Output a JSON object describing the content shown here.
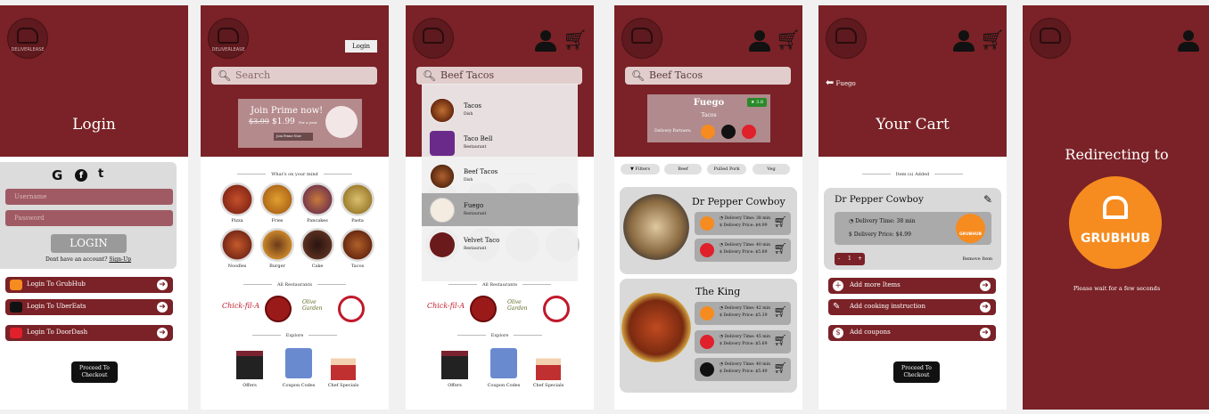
{
  "s1": {
    "title": "Login",
    "username": "Username",
    "password": "Password",
    "login": "LOGIN",
    "noacct": "Dont have an account?",
    "signup": "Sign-Up",
    "btns": [
      "Login To GrubHub",
      "Login To UberEats",
      "Login To DoorDash"
    ],
    "checkout": "Proceed To Checkout",
    "social": [
      "G",
      "f",
      "t"
    ],
    "logo": "DELIVERLEASE"
  },
  "s2": {
    "login": "Login",
    "search": "Search",
    "prime_title": "Join Prime now!",
    "prime_old": "$3.99",
    "prime_price": "$1.99",
    "prime_per": "For a year",
    "prime_btn": "Join Prime Now",
    "mind": "What's on your mind",
    "foods": [
      "Pizza",
      "Fries",
      "Pancakes",
      "Pasta",
      "Noodles",
      "Burger",
      "Cake",
      "Tacos"
    ],
    "allrest": "All Restaurants",
    "rests": [
      "Chick-fil-A",
      "Chipotle",
      "Olive Garden",
      "Panda Express"
    ],
    "explore": "Explore",
    "explore_items": [
      "Offers",
      "Coupon Codes",
      "Chef Specials"
    ],
    "logo": "DELIVERLEASE"
  },
  "s3": {
    "search": "Beef Tacos",
    "results": [
      {
        "name": "Tacos",
        "type": "Dish"
      },
      {
        "name": "Taco Bell",
        "type": "Restaurant"
      },
      {
        "name": "Beef Tacos",
        "type": "Dish"
      },
      {
        "name": "Fuego",
        "type": "Restaurant"
      },
      {
        "name": "Velvet Taco",
        "type": "Restaurant"
      }
    ],
    "allrest": "All Restaurants",
    "explore": "Explore",
    "explore_items": [
      "Offers",
      "Coupon Codes",
      "Chef Specials"
    ]
  },
  "s4": {
    "search": "Beef Tacos",
    "rest": "Fuego",
    "rating": "3.8",
    "cuisine": "Tacos",
    "partners": "Delivery Partners:",
    "filters": [
      "Filters",
      "Beef",
      "Pulled Pork",
      "Veg"
    ],
    "items": [
      {
        "name": "Dr Pepper Cowboy",
        "deliveries": [
          {
            "time": "Delivery Time: 38 min",
            "price": "Delivery Price: $4.99",
            "partner": "grubhub"
          },
          {
            "time": "Delivery Time: 40 min",
            "price": "Delivery Price: $5.89",
            "partner": "doordash"
          }
        ]
      },
      {
        "name": "The King",
        "deliveries": [
          {
            "time": "Delivery Time: 42 min",
            "price": "Delivery Price: $5.39",
            "partner": "grubhub"
          },
          {
            "time": "Delivery Time: 45 min",
            "price": "Delivery Price: $5.69",
            "partner": "doordash"
          },
          {
            "time": "Delivery Time: 40 min",
            "price": "Delivery Price: $5.49",
            "partner": "ubereats"
          }
        ]
      }
    ]
  },
  "s5": {
    "back": "Fuego",
    "title": "Your Cart",
    "added": "Item (s) Added",
    "item": "Dr Pepper Cowboy",
    "time": "Delivery Time: 38 min",
    "price": "Delivery Price: $4.99",
    "minus": "-",
    "qty": "1",
    "plus": "+",
    "remove": "Remove Item",
    "actions": [
      "Add more Items",
      "Add cooking instruction",
      "Add coupons"
    ],
    "checkout": "Proceed To Checkout",
    "partner": "GRUBHUB"
  },
  "s6": {
    "title": "Redirecting to",
    "brand": "GRUBHUB",
    "wait": "Please wait for a few seconds"
  },
  "colors": {
    "maroon": "#7a2227",
    "grubhub": "#f68b1f",
    "doordash": "#e0202a",
    "ubereats": "#111111"
  }
}
